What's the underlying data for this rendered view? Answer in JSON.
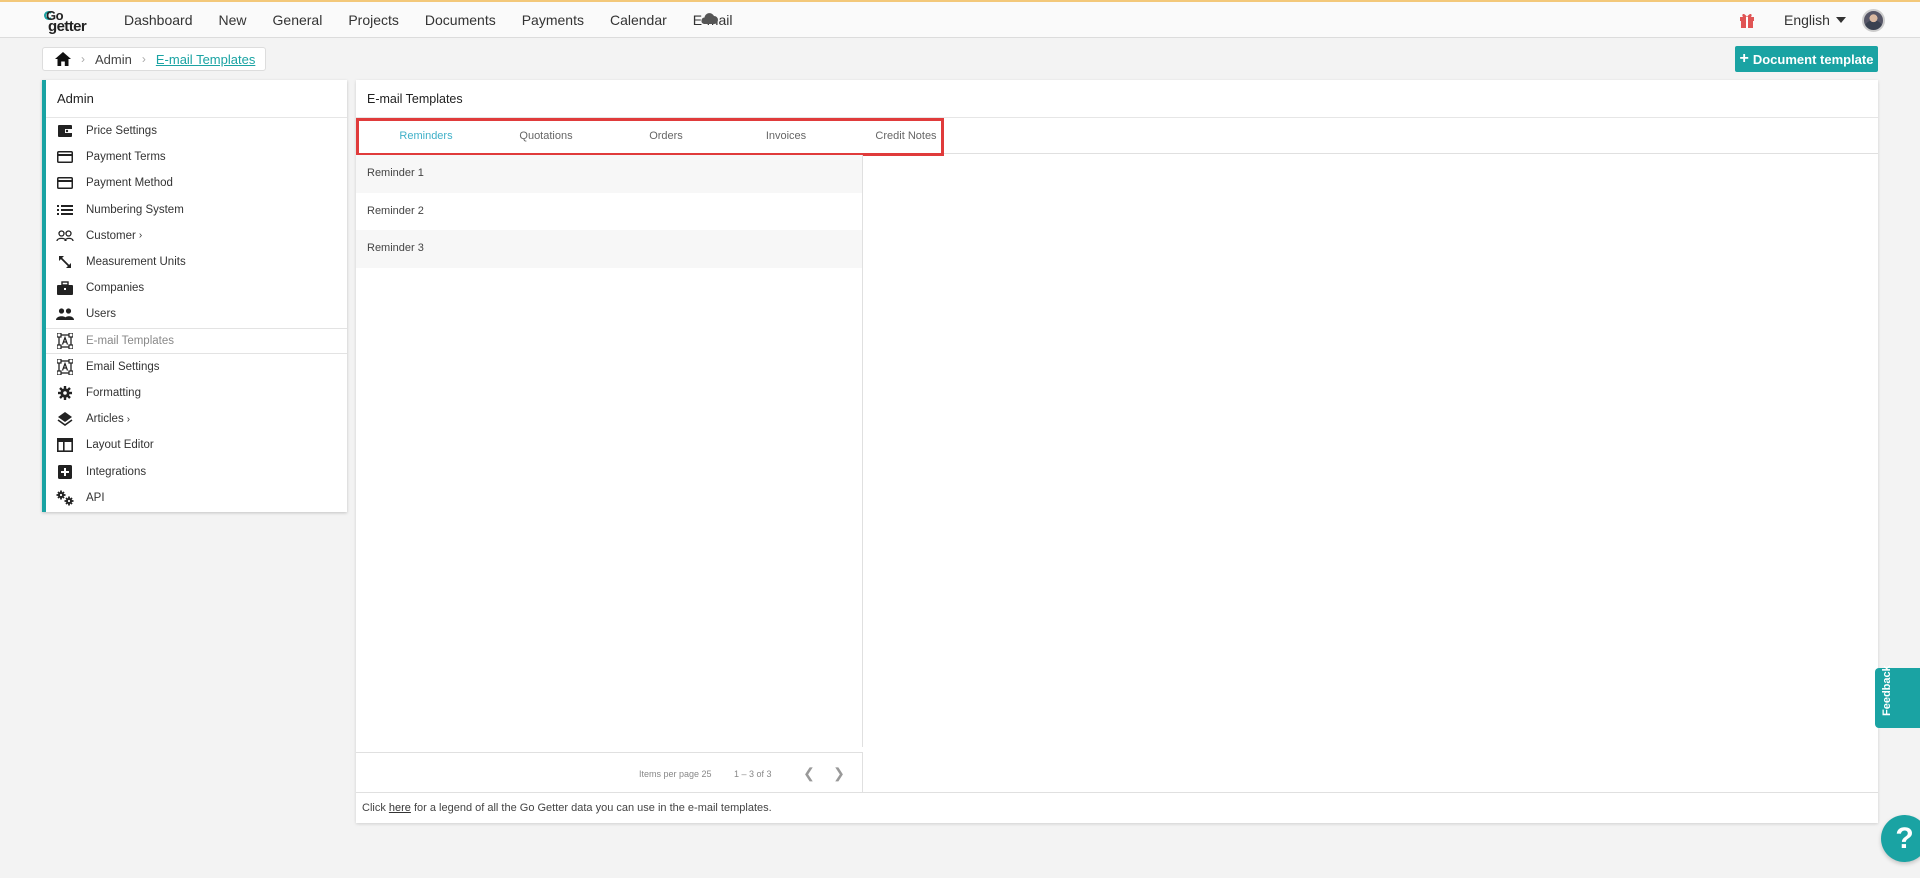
{
  "topbar": {
    "logo_top": "Go",
    "logo_bottom": "getter",
    "nav": [
      "Dashboard",
      "New",
      "General",
      "Projects",
      "Documents",
      "Payments",
      "Calendar",
      "E-mail"
    ],
    "language": "English"
  },
  "breadcrumb": {
    "items": [
      "Admin",
      "E-mail Templates"
    ]
  },
  "actions": {
    "document_template": "Document template"
  },
  "sidebar": {
    "title": "Admin",
    "items": [
      {
        "label": "Price Settings",
        "icon": "wallet-icon"
      },
      {
        "label": "Payment Terms",
        "icon": "credit-card-icon"
      },
      {
        "label": "Payment Method",
        "icon": "credit-card-icon"
      },
      {
        "label": "Numbering System",
        "icon": "list-icon"
      },
      {
        "label": "Customer",
        "icon": "people-outline-icon"
      },
      {
        "label": "Measurement Units",
        "icon": "resize-arrow-icon"
      },
      {
        "label": "Companies",
        "icon": "briefcase-icon"
      },
      {
        "label": "Users",
        "icon": "people-icon"
      },
      {
        "label": "E-mail Templates",
        "icon": "text-frame-icon"
      },
      {
        "label": "Email Settings",
        "icon": "text-frame-icon"
      },
      {
        "label": "Formatting",
        "icon": "gear-icon"
      },
      {
        "label": "Articles",
        "icon": "layers-icon"
      },
      {
        "label": "Layout Editor",
        "icon": "layout-icon"
      },
      {
        "label": "Integrations",
        "icon": "plus-box-icon"
      },
      {
        "label": "API",
        "icon": "gears-icon"
      }
    ]
  },
  "main": {
    "title": "E-mail Templates",
    "tabs": [
      "Reminders",
      "Quotations",
      "Orders",
      "Invoices",
      "Credit Notes"
    ],
    "active_tab": "Reminders",
    "rows": [
      "Reminder 1",
      "Reminder 2",
      "Reminder 3"
    ],
    "pager": {
      "items_per_page": "Items per page 25",
      "range": "1 – 3 of 3"
    },
    "footer": {
      "pre": "Click ",
      "link": "here",
      "post": " for a legend of all the Go Getter data you can use in the e-mail templates."
    }
  },
  "feedback": "Feedback",
  "help": "?",
  "colors": {
    "accent": "#1aa3a3",
    "active_tab": "#3fb0c8",
    "highlight": "#e03b3b"
  }
}
